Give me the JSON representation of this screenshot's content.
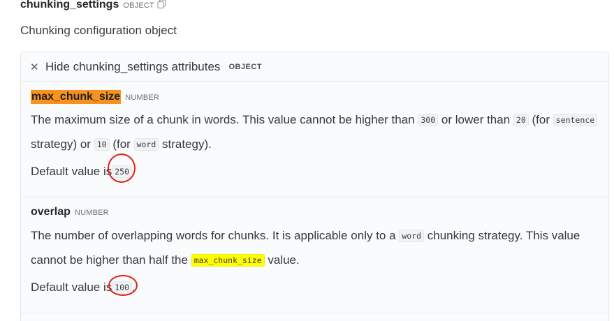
{
  "param": {
    "name": "chunking_settings",
    "type": "OBJECT",
    "description": "Chunking configuration object"
  },
  "attributes_toggle": {
    "label": "Hide chunking_settings attributes",
    "type": "OBJECT"
  },
  "attributes": [
    {
      "name": "max_chunk_size",
      "type": "NUMBER",
      "desc_1": "The maximum size of a chunk in words. This value cannot be higher than",
      "code_1": "300",
      "desc_2": "or lower than",
      "code_2": "20",
      "desc_3": "(for",
      "code_3": "sentence",
      "desc_4": "strategy) or",
      "code_4": "10",
      "desc_5": "(for",
      "code_5": "word",
      "desc_6": "strategy).",
      "default_prefix": "Default value is",
      "default_value": "250",
      "default_suffix": "."
    },
    {
      "name": "overlap",
      "type": "NUMBER",
      "desc_1": "The number of overlapping words for chunks. It is applicable only to a",
      "code_1": "word",
      "desc_2": "chunking strategy. This value cannot be higher than half the",
      "code_2": "max_chunk_size",
      "desc_3": "value.",
      "default_prefix": "Default value is",
      "default_value": "100",
      "default_suffix": "."
    }
  ],
  "colors": {
    "highlight_orange": "#f7921e",
    "highlight_yellow": "#ffff00",
    "annotation_red": "#e0211d"
  },
  "icons": [
    "copy-icon",
    "close-icon"
  ]
}
